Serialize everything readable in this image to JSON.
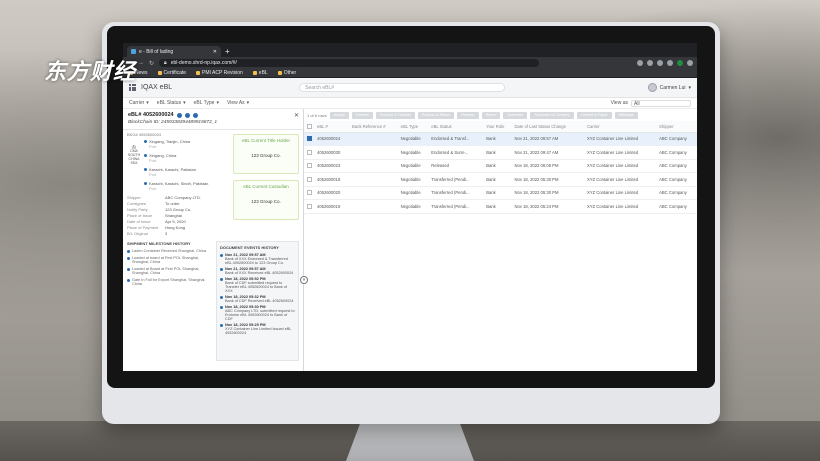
{
  "watermark": "东方财经",
  "browser": {
    "tab_title": "e - Bill of lading",
    "new_tab": "+",
    "url": "ebl-demo.shrd-np.iqax.com/#/",
    "bookmarks": [
      "News",
      "Certificate",
      "PMI ACP Revision",
      "eBL",
      "Other"
    ]
  },
  "app": {
    "name": "IQAX eBL",
    "search_placeholder": "Search eBL#",
    "user": "Carmen Lui"
  },
  "filters": [
    "Carrier",
    "eBL Status",
    "eBL Type",
    "View As"
  ],
  "view_as": {
    "label": "View as",
    "value": "All"
  },
  "detail": {
    "title": "eBL# 4052600024",
    "chain_id": "BlockChain ID: 2459338394489915872_1",
    "bl_number": "BKG# 4052600024",
    "vessel": "CMA SOUTH CHINA SEA",
    "stops": [
      {
        "place": "Xingang, Tianjin, China",
        "sub": "Port"
      },
      {
        "place": "Xingang, China",
        "sub": "Port"
      },
      {
        "place": "Karachi, Karachi, Pakistan",
        "sub": "Port"
      },
      {
        "place": "Karachi, Karachi, Sindh, Pakistan",
        "sub": "Port"
      }
    ],
    "fields": [
      {
        "k": "Shipper",
        "v": "ABC Company LTD."
      },
      {
        "k": "Consignee",
        "v": "To order"
      },
      {
        "k": "Notify Party",
        "v": "123 Group Co."
      },
      {
        "k": "Place of Issue",
        "v": "Shanghai"
      },
      {
        "k": "Date of Issue",
        "v": "Apr 5, 2020"
      },
      {
        "k": "Place of Payment",
        "v": "Hong Kong"
      },
      {
        "k": "B/L Original",
        "v": "3"
      }
    ],
    "cards": [
      {
        "title": "eBL Current Title Holder",
        "value": "123 Group Co."
      },
      {
        "title": "eBL Current Custodian",
        "value": "123 Group Co."
      }
    ],
    "milestone_title": "SHIPMENT MILESTONE HISTORY",
    "milestones": [
      "Laden Container Received Shanghai, China",
      "Loaded at board at First POL Shanghai, Shanghai, China",
      "Loaded at Board at First POL Shanghai, Shanghai, China",
      "Gate In Full for Export Shanghai, Shanghai, China"
    ],
    "events_title": "DOCUMENT EVENTS HISTORY",
    "events": [
      {
        "time": "Nov 21, 2022 09:57 AM",
        "text": "Bank of XXX Endorsed & Transferred eBL 4052600024 to 123 Group Co."
      },
      {
        "time": "Nov 21, 2022 09:57 AM",
        "text": "Bank of XXX Received eBL 4052600024"
      },
      {
        "time": "Nov 18, 2022 05:52 PM",
        "text": "Bank of CDF submitted request to Transfer eBL 4052600024 to Bank of XXX"
      },
      {
        "time": "Nov 18, 2022 05:32 PM",
        "text": "Bank of CDF Received eBL 4052600024"
      },
      {
        "time": "Nov 18, 2022 05:30 PM",
        "text": "ABC Company LTD. submitted request to Endorse eBL 4052600024 to Bank of CDF"
      },
      {
        "time": "Nov 18, 2022 05:25 PM",
        "text": "XYZ Container Line Limited Issued eBL 4052600024"
      }
    ],
    "collapse": "«"
  },
  "list": {
    "count": "1 of 6 rows",
    "actions": [
      "Accept",
      "Transfer",
      "Endorse & Transfer",
      "Endorse & Return",
      "Release",
      "Return",
      "Surrender",
      "Surrender for Delivery",
      "Convert to Paper",
      "Withdraw"
    ],
    "columns": [
      "eBL #",
      "Bank Reference #",
      "eBL Type",
      "eBL Status",
      "Your Role",
      "Date of Last Status Change",
      "Carrier",
      "Shipper"
    ],
    "rows": [
      {
        "ebl": "4052600024",
        "ref": "",
        "type": "Negotiable",
        "status": "Endorsed & Transf...",
        "role": "Bank",
        "date": "Nov 21, 2022 09:57 AM",
        "carrier": "XYZ Container Line Limited",
        "shipper": "ABC Company",
        "selected": true
      },
      {
        "ebl": "4052600030",
        "ref": "",
        "type": "Negotiable",
        "status": "Endorsed & Surre...",
        "role": "Bank",
        "date": "Nov 21, 2022 09:47 AM",
        "carrier": "XYZ Container Line Limited",
        "shipper": "ABC Company",
        "selected": false
      },
      {
        "ebl": "4052600023",
        "ref": "",
        "type": "Negotiable",
        "status": "Released",
        "role": "Bank",
        "date": "Nov 18, 2022 06:06 PM",
        "carrier": "XYZ Container Line Limited",
        "shipper": "ABC Company",
        "selected": false
      },
      {
        "ebl": "4052600018",
        "ref": "",
        "type": "Negotiable",
        "status": "Transferred (Pendi...",
        "role": "Bank",
        "date": "Nov 18, 2022 05:30 PM",
        "carrier": "XYZ Container Line Limited",
        "shipper": "ABC Company",
        "selected": false
      },
      {
        "ebl": "4052600020",
        "ref": "",
        "type": "Negotiable",
        "status": "Transferred (Pendi...",
        "role": "Bank",
        "date": "Nov 18, 2022 05:30 PM",
        "carrier": "XYZ Container Line Limited",
        "shipper": "ABC Company",
        "selected": false
      },
      {
        "ebl": "4052600019",
        "ref": "",
        "type": "Negotiable",
        "status": "Transferred (Pendi...",
        "role": "Bank",
        "date": "Nov 18, 2022 05:24 PM",
        "carrier": "XYZ Container Line Limited",
        "shipper": "ABC Company",
        "selected": false
      }
    ]
  }
}
